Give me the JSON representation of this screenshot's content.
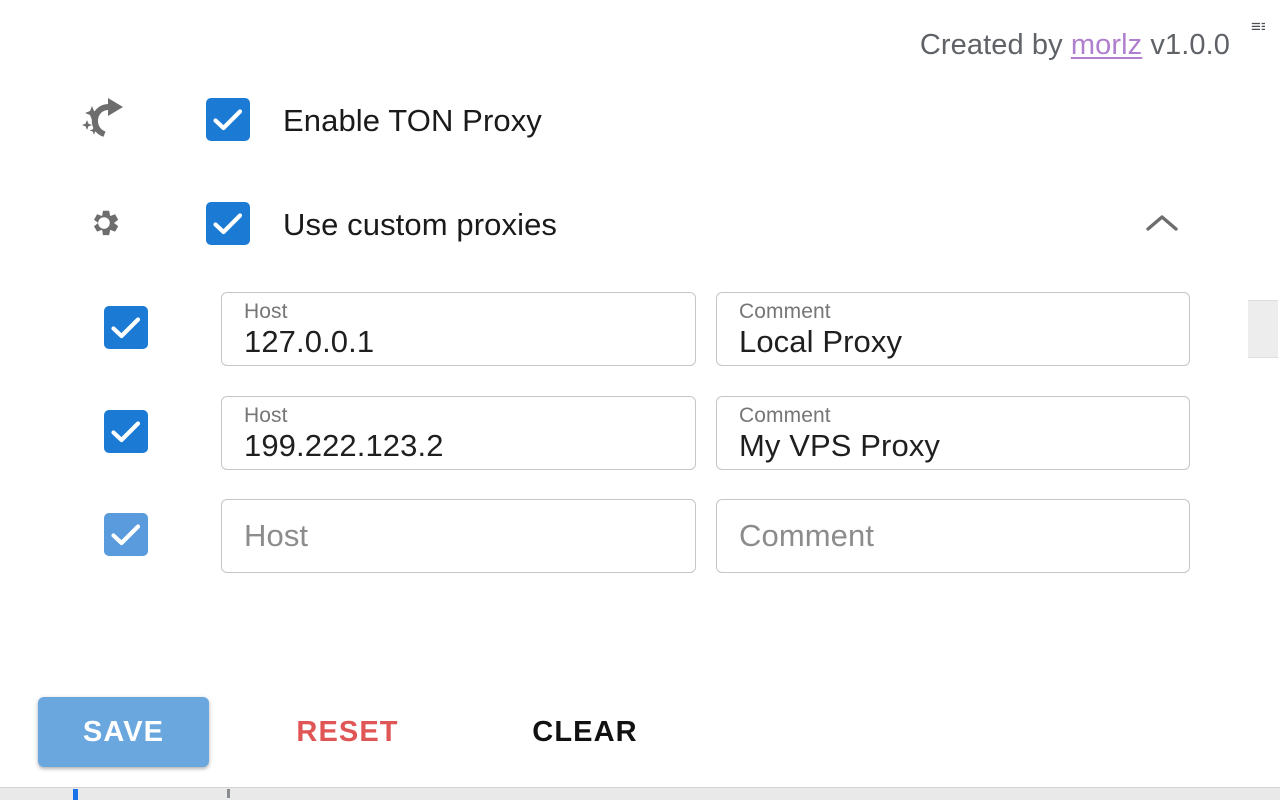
{
  "credit": {
    "prefix": "Created by ",
    "author": "morlz",
    "version": " v1.0.0"
  },
  "options": [
    {
      "icon": "ton-sparkle-arrow-icon",
      "label": "Enable TON Proxy",
      "checked": true
    },
    {
      "icon": "gear-icon",
      "label": "Use custom proxies",
      "checked": true,
      "collapse_icon": "chevron-up-icon"
    }
  ],
  "proxies": {
    "host_label": "Host",
    "comment_label": "Comment",
    "host_placeholder": "Host",
    "comment_placeholder": "Comment",
    "rows": [
      {
        "enabled": true,
        "host": "127.0.0.1",
        "comment": "Local Proxy"
      },
      {
        "enabled": true,
        "host": "199.222.123.2",
        "comment": "My VPS Proxy"
      },
      {
        "enabled": true,
        "host": "",
        "comment": ""
      }
    ]
  },
  "actions": {
    "save": "SAVE",
    "reset": "RESET",
    "clear": "CLEAR"
  },
  "colors": {
    "checkbox_active": "#1a7ad4",
    "checkbox_light": "#5a9bdd",
    "save_button": "#6aa7df",
    "reset_text": "#e05555",
    "link": "#b07fce",
    "label_gray": "#767676"
  }
}
